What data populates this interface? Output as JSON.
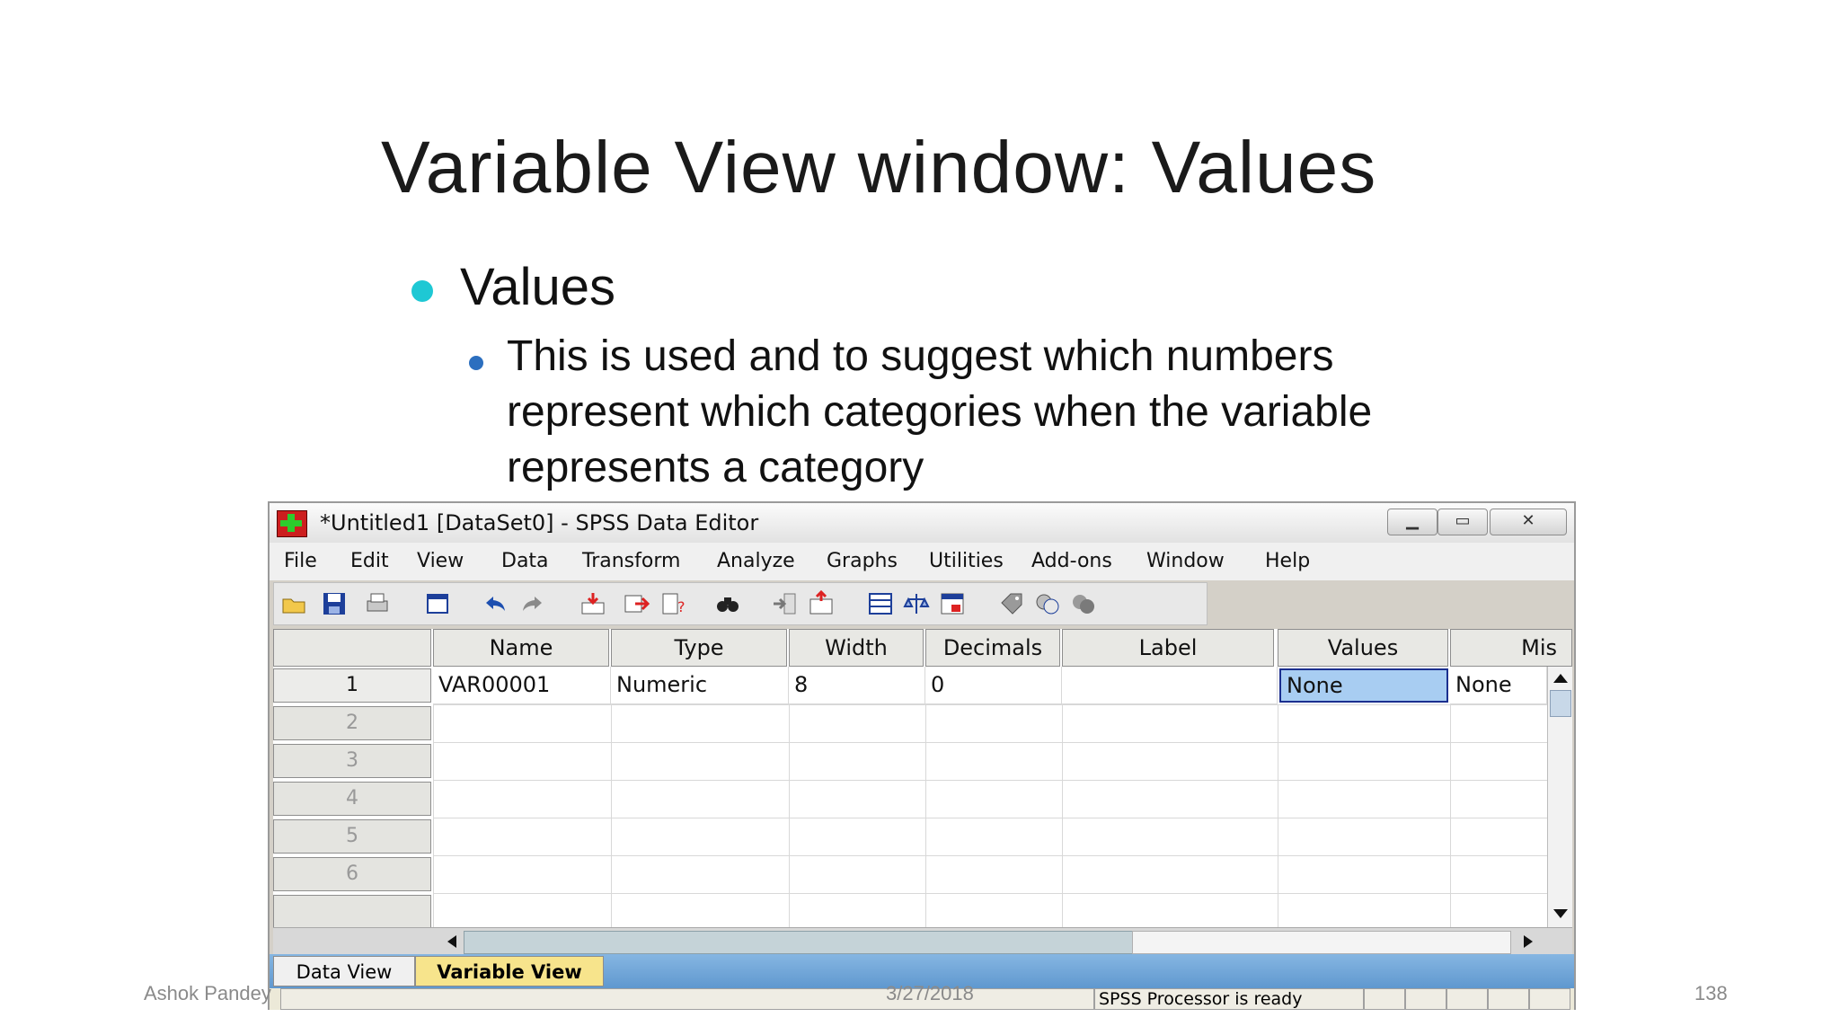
{
  "slide": {
    "title": "Variable View window: Values",
    "bullet_level1": "Values",
    "bullet_level2": "This is used and to suggest which numbers represent which categories when the variable represents a category",
    "footer_left": "Ashok Pandey",
    "footer_date": "3/27/2018",
    "footer_page": "138"
  },
  "window": {
    "title": "*Untitled1 [DataSet0] - SPSS Data Editor",
    "controls": {
      "minimize": "▁",
      "maximize": "▭",
      "close": "✕"
    }
  },
  "menu": [
    "File",
    "Edit",
    "View",
    "Data",
    "Transform",
    "Analyze",
    "Graphs",
    "Utilities",
    "Add-ons",
    "Window",
    "Help"
  ],
  "toolbar_icons": [
    "open-folder-icon",
    "save-icon",
    "print-icon",
    "dialog-recall-icon",
    "undo-icon",
    "redo-icon",
    "goto-case-icon",
    "insert-variable-icon",
    "variables-icon",
    "find-icon",
    "insert-cases-icon",
    "insert-case-icon",
    "split-file-icon",
    "weight-cases-icon",
    "select-cases-icon",
    "value-labels-icon",
    "use-sets-icon",
    "show-all-icon"
  ],
  "grid": {
    "columns": [
      "Name",
      "Type",
      "Width",
      "Decimals",
      "Label",
      "Values",
      "Mis"
    ],
    "row_numbers": [
      "1",
      "2",
      "3",
      "4",
      "5",
      "6"
    ],
    "rows": [
      [
        "VAR00001",
        "Numeric",
        "8",
        "0",
        "",
        "None",
        "None"
      ]
    ],
    "selected_cell": "None"
  },
  "tabs": {
    "data_view": "Data View",
    "variable_view": "Variable View",
    "active": "Variable View"
  },
  "status": {
    "processor": "SPSS  Processor is ready"
  },
  "colors": {
    "accent_bullet": "#1ec8d4",
    "sub_bullet": "#2c6fbf",
    "selected_cell_bg": "#a8cdf2",
    "active_tab": "#f7e48c",
    "tab_strip": "#6ea4d8"
  }
}
